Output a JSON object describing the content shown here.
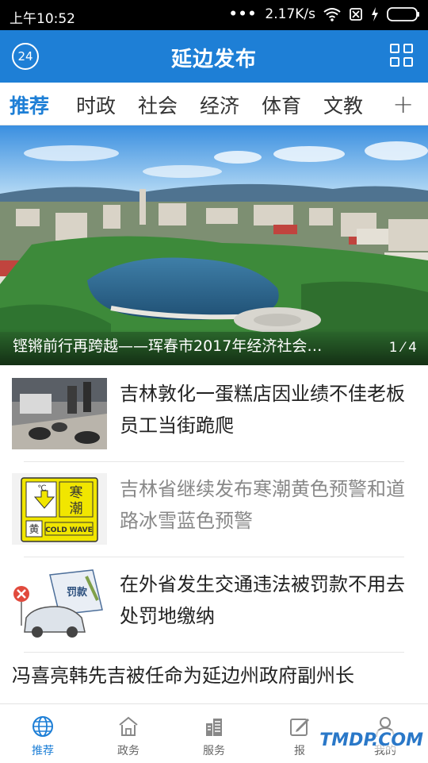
{
  "status_bar": {
    "time": "上午10:52",
    "network_speed": "2.17K/s"
  },
  "app_bar": {
    "badge": "24",
    "title": "延边发布"
  },
  "tabs": [
    {
      "label": "推荐",
      "active": true
    },
    {
      "label": "时政",
      "active": false
    },
    {
      "label": "社会",
      "active": false
    },
    {
      "label": "经济",
      "active": false
    },
    {
      "label": "体育",
      "active": false
    },
    {
      "label": "文教",
      "active": false
    }
  ],
  "tab_add_glyph": "+",
  "hero": {
    "caption": "铿锵前行再跨越——珲春市2017年经济社会…",
    "page_current": "1",
    "page_total": "4"
  },
  "news": [
    {
      "title": "吉林敦化一蛋糕店因业绩不佳老板员工当街跪爬",
      "read": false,
      "thumb": "street-crawling-photo"
    },
    {
      "title": "吉林省继续发布寒潮黄色预警和道路冰雪蓝色预警",
      "read": true,
      "thumb": "cold-wave-warning-sign",
      "thumb_text": [
        "寒",
        "潮",
        "黄",
        "COLD WAVE",
        "℃"
      ]
    },
    {
      "title": "在外省发生交通违法被罚款不用去处罚地缴纳",
      "read": false,
      "thumb": "traffic-fine-cartoon",
      "thumb_text": "罚款"
    },
    {
      "title": "冯喜亮韩先吉被任命为延边州政府副州长",
      "read": false
    }
  ],
  "bottom_nav": [
    {
      "label": "推荐",
      "icon": "globe-icon",
      "active": true
    },
    {
      "label": "政务",
      "icon": "building-icon",
      "active": false
    },
    {
      "label": "服务",
      "icon": "city-icon",
      "active": false
    },
    {
      "label": "报",
      "icon": "edit-icon",
      "active": false
    },
    {
      "label": "我的",
      "icon": "person-icon",
      "active": false
    }
  ],
  "watermark": "TMDP.COM",
  "colors": {
    "primary": "#1e7fd6",
    "text": "#222222",
    "read_text": "#888888"
  }
}
